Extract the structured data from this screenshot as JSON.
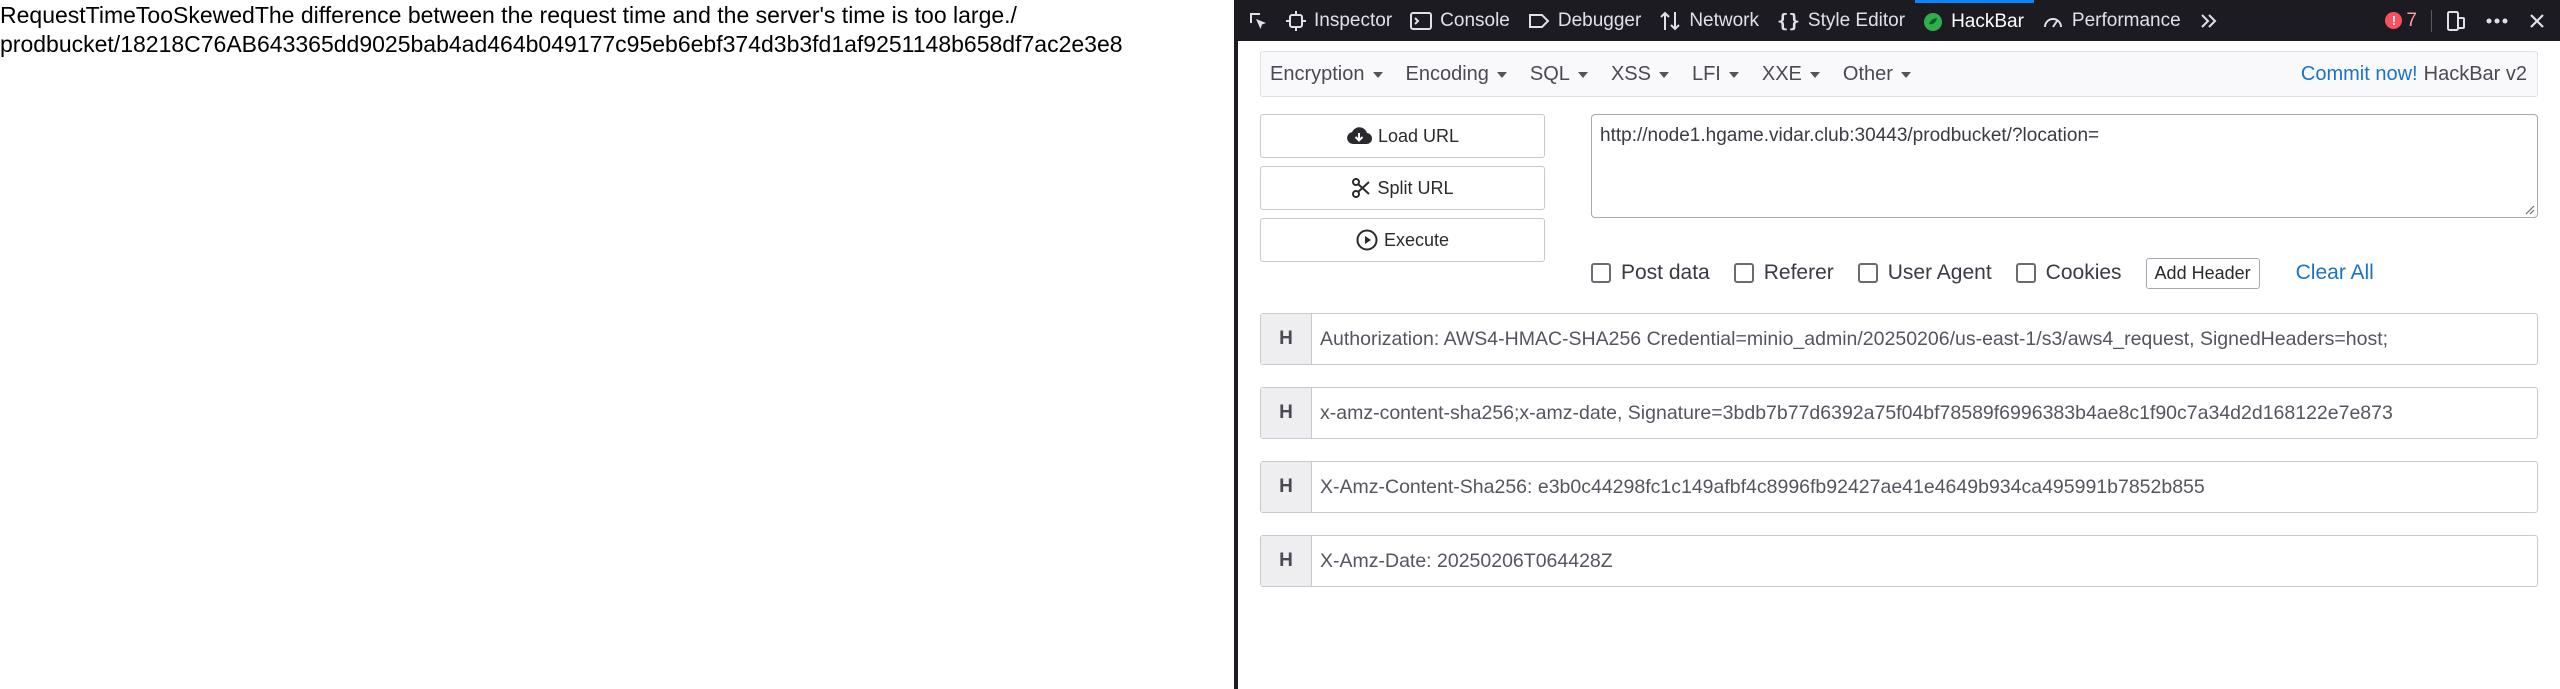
{
  "page": {
    "line1": "RequestTimeTooSkewedThe difference between the request time and the server's time is too large./",
    "line2": "prodbucket/18218C76AB643365dd9025bab4ad464b049177c95eb6ebf374d3b3fd1af9251148b658df7ac2e3e8"
  },
  "devtools": {
    "tabs": [
      {
        "label": "Inspector",
        "icon": "inspector-icon"
      },
      {
        "label": "Console",
        "icon": "console-icon"
      },
      {
        "label": "Debugger",
        "icon": "debugger-icon"
      },
      {
        "label": "Network",
        "icon": "network-icon"
      },
      {
        "label": "Style Editor",
        "icon": "style-editor-icon"
      },
      {
        "label": "HackBar",
        "icon": "hackbar-icon",
        "active": true
      },
      {
        "label": "Performance",
        "icon": "performance-icon"
      }
    ],
    "error_count": "7",
    "accent_color": "#0a84ff",
    "toolbar_bg": "#1c1b22"
  },
  "hackbar": {
    "menu": [
      "Encryption",
      "Encoding",
      "SQL",
      "XSS",
      "LFI",
      "XXE",
      "Other"
    ],
    "commit_label": "Commit now!",
    "version_label": "HackBar v2",
    "load_url": "Load URL",
    "split_url": "Split URL",
    "execute": "Execute",
    "url_value": "http://node1.hgame.vidar.club:30443/prodbucket/?location=",
    "options": [
      "Post data",
      "Referer",
      "User Agent",
      "Cookies"
    ],
    "add_header": "Add Header",
    "clear_all": "Clear All",
    "headers": [
      {
        "tag": "H",
        "value": "Authorization: AWS4-HMAC-SHA256 Credential=minio_admin/20250206/us-east-1/s3/aws4_request, SignedHeaders=host;"
      },
      {
        "tag": "H",
        "value": "x-amz-content-sha256;x-amz-date, Signature=3bdb7b77d6392a75f04bf78589f6996383b4ae8c1f90c7a34d2d168122e7e873"
      },
      {
        "tag": "H",
        "value": "X-Amz-Content-Sha256: e3b0c44298fc1c149afbf4c8996fb92427ae41e4649b934ca495991b7852b855"
      },
      {
        "tag": "H",
        "value": "X-Amz-Date: 20250206T064428Z"
      }
    ]
  }
}
